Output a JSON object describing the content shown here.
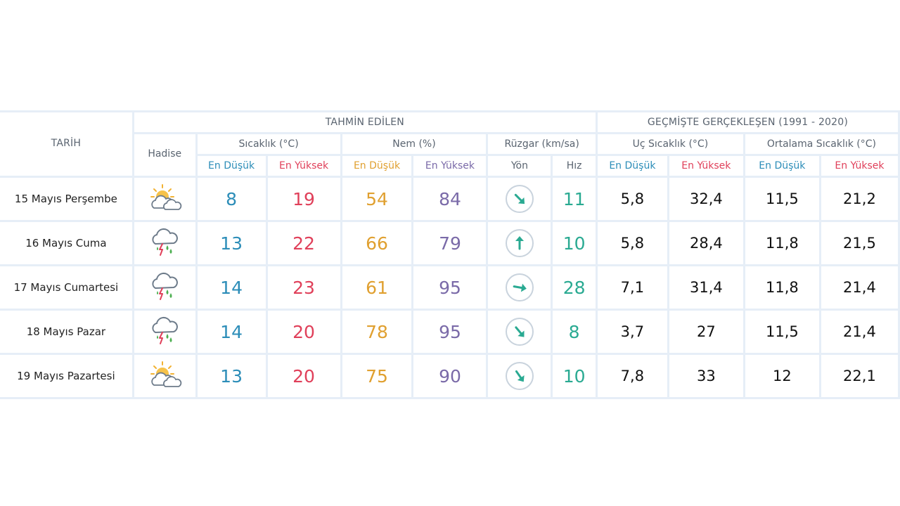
{
  "headers": {
    "tarih": "TARİH",
    "hadise": "Hadise",
    "tahmin": "TAHMİN EDİLEN",
    "gecmis": "GEÇMİŞTE GERÇEKLEŞEN (1991 - 2020)",
    "sicaklik": "Sıcaklık (°C)",
    "nem": "Nem (%)",
    "ruzgar": "Rüzgar (km/sa)",
    "uc_sicaklik": "Uç Sıcaklık (°C)",
    "ort_sicaklik": "Ortalama Sıcaklık (°C)",
    "en_dusuk": "En Düşük",
    "en_yuksek": "En Yüksek",
    "yon": "Yön",
    "hiz": "Hız"
  },
  "colors": {
    "low": "#2c8db8",
    "high": "#e0405a",
    "humidity_low": "#e0a030",
    "humidity_high": "#7a6aa8",
    "wind": "#2aaa92"
  },
  "rows": [
    {
      "date": "15 Mayıs Perşembe",
      "icon": "partly-cloudy-sun-icon",
      "temp_low": "8",
      "temp_high": "19",
      "hum_low": "54",
      "hum_high": "84",
      "wind_dir": "arrow-southeast-icon",
      "wind_angle": 135,
      "wind_speed": "11",
      "ext_low": "5,8",
      "ext_high": "32,4",
      "avg_low": "11,5",
      "avg_high": "21,2"
    },
    {
      "date": "16 Mayıs Cuma",
      "icon": "thunderstorm-rain-icon",
      "temp_low": "13",
      "temp_high": "22",
      "hum_low": "66",
      "hum_high": "79",
      "wind_dir": "arrow-north-icon",
      "wind_angle": 0,
      "wind_speed": "10",
      "ext_low": "5,8",
      "ext_high": "28,4",
      "avg_low": "11,8",
      "avg_high": "21,5"
    },
    {
      "date": "17 Mayıs Cumartesi",
      "icon": "thunderstorm-rain-icon",
      "temp_low": "14",
      "temp_high": "23",
      "hum_low": "61",
      "hum_high": "95",
      "wind_dir": "arrow-east-icon",
      "wind_angle": 100,
      "wind_speed": "28",
      "ext_low": "7,1",
      "ext_high": "31,4",
      "avg_low": "11,8",
      "avg_high": "21,4"
    },
    {
      "date": "18 Mayıs Pazar",
      "icon": "thunderstorm-rain-icon",
      "temp_low": "14",
      "temp_high": "20",
      "hum_low": "78",
      "hum_high": "95",
      "wind_dir": "arrow-southeast-icon",
      "wind_angle": 140,
      "wind_speed": "8",
      "ext_low": "3,7",
      "ext_high": "27",
      "avg_low": "11,5",
      "avg_high": "21,4"
    },
    {
      "date": "19 Mayıs Pazartesi",
      "icon": "partly-cloudy-sun-icon",
      "temp_low": "13",
      "temp_high": "20",
      "hum_low": "75",
      "hum_high": "90",
      "wind_dir": "arrow-southeast-icon",
      "wind_angle": 145,
      "wind_speed": "10",
      "ext_low": "7,8",
      "ext_high": "33",
      "avg_low": "12",
      "avg_high": "22,1"
    }
  ]
}
